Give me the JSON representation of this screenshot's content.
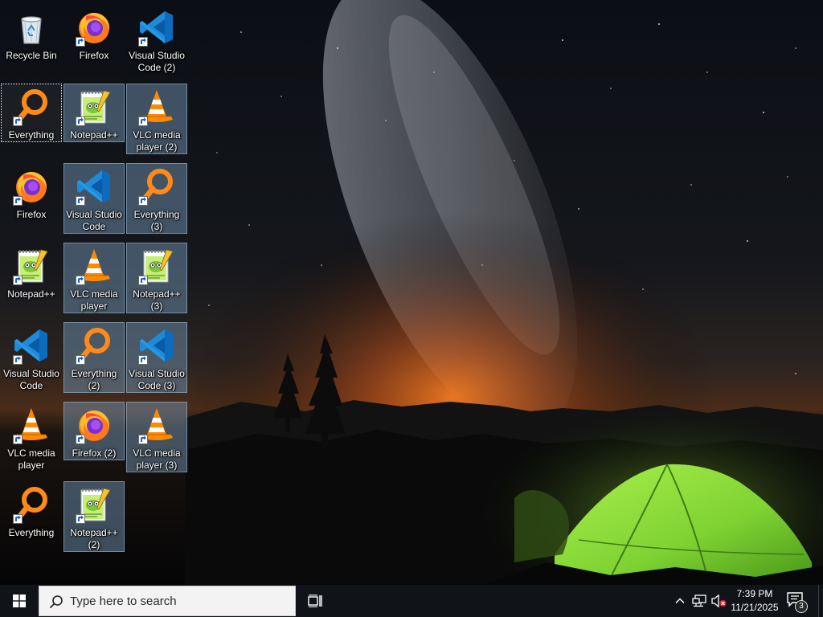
{
  "desktop": {
    "icons": [
      {
        "id": "recycle-bin",
        "label": "Recycle Bin",
        "type": "recycle",
        "shortcut": false,
        "selected": false,
        "focused": false
      },
      {
        "id": "firefox",
        "label": "Firefox",
        "type": "firefox",
        "shortcut": true,
        "selected": false,
        "focused": false
      },
      {
        "id": "visual-studio-code-2",
        "label": "Visual Studio Code (2)",
        "type": "vscode",
        "shortcut": true,
        "selected": false,
        "focused": false
      },
      {
        "id": "everything",
        "label": "Everything",
        "type": "everything",
        "shortcut": true,
        "selected": false,
        "focused": true
      },
      {
        "id": "notepad-plus-plus",
        "label": "Notepad++",
        "type": "notepad",
        "shortcut": true,
        "selected": true,
        "focused": false
      },
      {
        "id": "vlc-media-player-2",
        "label": "VLC media player (2)",
        "type": "vlc",
        "shortcut": true,
        "selected": true,
        "focused": false
      },
      {
        "id": "firefox-b",
        "label": "Firefox",
        "type": "firefox",
        "shortcut": true,
        "selected": false,
        "focused": false
      },
      {
        "id": "visual-studio-code",
        "label": "Visual Studio Code",
        "type": "vscode",
        "shortcut": true,
        "selected": true,
        "focused": false
      },
      {
        "id": "everything-3",
        "label": "Everything (3)",
        "type": "everything",
        "shortcut": true,
        "selected": true,
        "focused": false
      },
      {
        "id": "notepad-plus-plus-b",
        "label": "Notepad++",
        "type": "notepad",
        "shortcut": true,
        "selected": false,
        "focused": false
      },
      {
        "id": "vlc-media-player",
        "label": "VLC media player",
        "type": "vlc",
        "shortcut": true,
        "selected": true,
        "focused": false
      },
      {
        "id": "notepad-plus-plus-3",
        "label": "Notepad++ (3)",
        "type": "notepad",
        "shortcut": true,
        "selected": true,
        "focused": false
      },
      {
        "id": "visual-studio-code-b",
        "label": "Visual Studio Code",
        "type": "vscode",
        "shortcut": true,
        "selected": false,
        "focused": false
      },
      {
        "id": "everything-2",
        "label": "Everything (2)",
        "type": "everything",
        "shortcut": true,
        "selected": true,
        "focused": false
      },
      {
        "id": "visual-studio-code-3",
        "label": "Visual Studio Code (3)",
        "type": "vscode",
        "shortcut": true,
        "selected": true,
        "focused": false
      },
      {
        "id": "vlc-media-player-b",
        "label": "VLC media player",
        "type": "vlc",
        "shortcut": true,
        "selected": false,
        "focused": false
      },
      {
        "id": "firefox-2",
        "label": "Firefox (2)",
        "type": "firefox",
        "shortcut": true,
        "selected": true,
        "focused": false
      },
      {
        "id": "vlc-media-player-3",
        "label": "VLC media player (3)",
        "type": "vlc",
        "shortcut": true,
        "selected": true,
        "focused": false
      },
      {
        "id": "everything-b",
        "label": "Everything",
        "type": "everything",
        "shortcut": true,
        "selected": false,
        "focused": false
      },
      {
        "id": "notepad-plus-plus-2",
        "label": "Notepad++ (2)",
        "type": "notepad",
        "shortcut": true,
        "selected": true,
        "focused": false
      }
    ]
  },
  "taskbar": {
    "start_icon": "windows-logo-icon",
    "search": {
      "placeholder": "Type here to search",
      "icon": "search-icon"
    },
    "task_view_icon": "task-view-icon",
    "tray": {
      "chevron_icon": "chevron-up-icon",
      "network_icon": "network-icon",
      "volume_icon": "volume-muted-icon",
      "time": "7:39 PM",
      "date": "11/21/2025",
      "notification_count": "3"
    }
  },
  "colors": {
    "taskbar": "#101419",
    "selection": "#7092b0",
    "tent": "#8ee03a",
    "horizon_glow": "#e0681e"
  }
}
